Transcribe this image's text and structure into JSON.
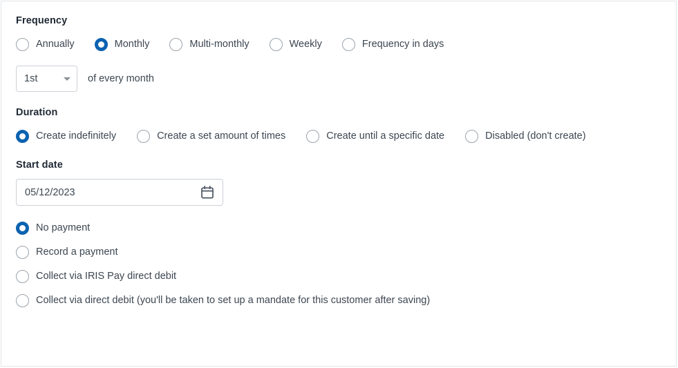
{
  "frequency": {
    "heading": "Frequency",
    "options": [
      {
        "label": "Annually",
        "selected": false
      },
      {
        "label": "Monthly",
        "selected": true
      },
      {
        "label": "Multi-monthly",
        "selected": false
      },
      {
        "label": "Weekly",
        "selected": false
      },
      {
        "label": "Frequency in days",
        "selected": false
      }
    ],
    "day_select": {
      "value": "1st",
      "icon": "chevron-down-icon"
    },
    "suffix": "of every month"
  },
  "duration": {
    "heading": "Duration",
    "options": [
      {
        "label": "Create indefinitely",
        "selected": true
      },
      {
        "label": "Create a set amount of times",
        "selected": false
      },
      {
        "label": "Create until a specific date",
        "selected": false
      },
      {
        "label": "Disabled (don't create)",
        "selected": false
      }
    ]
  },
  "start_date": {
    "heading": "Start date",
    "value": "05/12/2023",
    "icon": "calendar-icon"
  },
  "payment": {
    "options": [
      {
        "label": "No payment",
        "selected": true
      },
      {
        "label": "Record a payment",
        "selected": false
      },
      {
        "label": "Collect via IRIS Pay direct debit",
        "selected": false
      },
      {
        "label": "Collect via direct debit (you'll be taken to set up a mandate for this customer after saving)",
        "selected": false
      }
    ]
  },
  "colors": {
    "accent": "#0b62b0",
    "label_text": "#3c4650",
    "heading_text": "#1f2933",
    "border": "#ccd1d6",
    "card_border": "#e2e5e8",
    "radio_border": "#9ba2a9"
  }
}
